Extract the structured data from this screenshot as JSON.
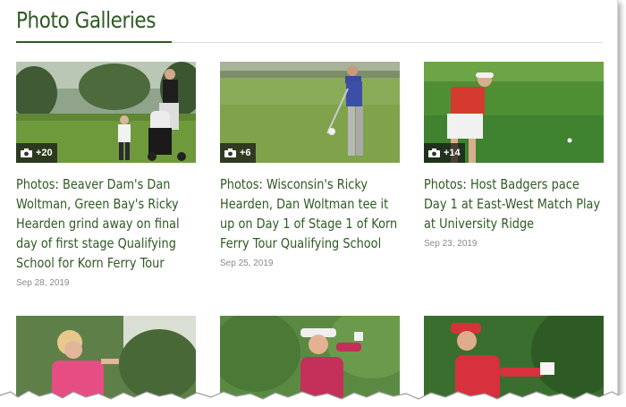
{
  "section": {
    "title": "Photo Galleries"
  },
  "galleries": [
    {
      "photo_count": "+20",
      "title": "Photos: Beaver Dam's Dan Woltman, Green Bay's Ricky Hearden grind away on final day of first stage Qualifying School for Korn Ferry Tour",
      "date": "Sep 28, 2019"
    },
    {
      "photo_count": "+6",
      "title": "Photos: Wisconsin's Ricky Hearden, Dan Woltman tee it up on Day 1 of Stage 1 of Korn Ferry Tour Qualifying School",
      "date": "Sep 25, 2019"
    },
    {
      "photo_count": "+14",
      "title": "Photos: Host Badgers pace Day 1 at East-West Match Play at University Ridge",
      "date": "Sep 23, 2019"
    },
    {
      "photo_count": "",
      "title": "",
      "date": ""
    },
    {
      "photo_count": "",
      "title": "",
      "date": ""
    },
    {
      "photo_count": "",
      "title": "",
      "date": ""
    }
  ],
  "colors": {
    "heading": "#2f5a23",
    "title": "#2f5a23",
    "date": "#8a8a8a",
    "fairway": "#6f9a3c"
  },
  "icons": {
    "photo_count": "camera-icon"
  }
}
